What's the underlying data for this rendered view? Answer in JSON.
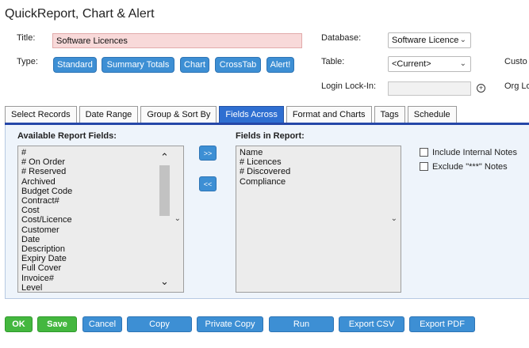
{
  "page_title": "QuickReport, Chart & Alert",
  "form": {
    "title_label": "Title:",
    "title_value": "Software Licences",
    "type_label": "Type:",
    "type_buttons": [
      "Standard",
      "Summary Totals",
      "Chart",
      "CrossTab",
      "Alert!"
    ],
    "database_label": "Database:",
    "database_value": "Software Licence",
    "table_label": "Table:",
    "table_value": "<Current>",
    "login_lock_label": "Login Lock-In:",
    "login_lock_value": "",
    "custom_label_partial": "Custo",
    "org_label_partial": "Org Lo"
  },
  "tabs": [
    {
      "label": "Select Records",
      "active": false
    },
    {
      "label": "Date Range",
      "active": false
    },
    {
      "label": "Group & Sort By",
      "active": false
    },
    {
      "label": "Fields Across",
      "active": true
    },
    {
      "label": "Format and Charts",
      "active": false
    },
    {
      "label": "Tags",
      "active": false
    },
    {
      "label": "Schedule",
      "active": false
    }
  ],
  "fields_across": {
    "available_header": "Available Report Fields:",
    "available_fields": [
      "#",
      "# On Order",
      "# Reserved",
      "Archived",
      "Budget Code",
      "Contract#",
      "Cost",
      "Cost/Licence",
      "Customer",
      "Date",
      "Description",
      "Expiry Date",
      "Full Cover",
      "Invoice#",
      "Level"
    ],
    "add_button": ">>",
    "remove_button": "<<",
    "in_report_header": "Fields in Report:",
    "in_report_fields": [
      "Name",
      "# Licences",
      "# Discovered",
      "Compliance"
    ],
    "include_internal_notes": "Include Internal Notes",
    "exclude_notes": "Exclude \"***\" Notes"
  },
  "footer": {
    "ok": "OK",
    "save": "Save",
    "cancel": "Cancel",
    "copy": "Copy",
    "private_copy": "Private Copy",
    "run": "Run",
    "export_csv": "Export CSV",
    "export_pdf": "Export PDF"
  },
  "colors": {
    "primary_button": "#3d8fd4",
    "save_button": "#44b73f",
    "active_tab": "#2f6fd1",
    "tab_rule": "#2547a8",
    "title_input_bg": "#f8d9d9",
    "panel_bg": "#eef4fb"
  }
}
